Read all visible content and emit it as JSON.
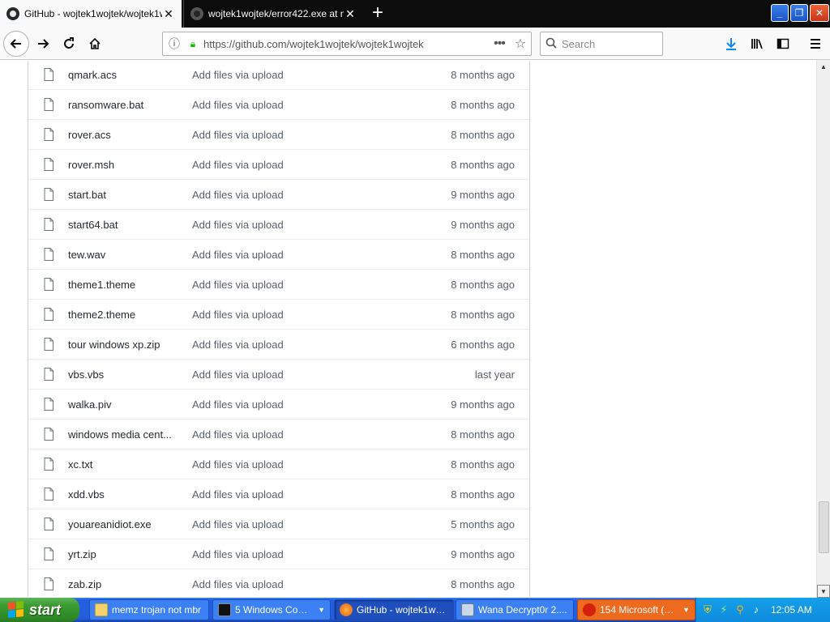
{
  "browser": {
    "tabs": [
      {
        "title": "GitHub - wojtek1wojtek/wojtek1w",
        "active": true
      },
      {
        "title": "wojtek1wojtek/error422.exe at m",
        "active": false
      }
    ],
    "new_tab_icon": "plus-icon",
    "url": "https://github.com/wojtek1wojtek/wojtek1wojtek",
    "search_placeholder": "Search"
  },
  "files": [
    {
      "name": "qmark.acs",
      "message": "Add files via upload",
      "age": "8 months ago"
    },
    {
      "name": "ransomware.bat",
      "message": "Add files via upload",
      "age": "8 months ago"
    },
    {
      "name": "rover.acs",
      "message": "Add files via upload",
      "age": "8 months ago"
    },
    {
      "name": "rover.msh",
      "message": "Add files via upload",
      "age": "8 months ago"
    },
    {
      "name": "start.bat",
      "message": "Add files via upload",
      "age": "9 months ago"
    },
    {
      "name": "start64.bat",
      "message": "Add files via upload",
      "age": "9 months ago"
    },
    {
      "name": "tew.wav",
      "message": "Add files via upload",
      "age": "8 months ago"
    },
    {
      "name": "theme1.theme",
      "message": "Add files via upload",
      "age": "8 months ago"
    },
    {
      "name": "theme2.theme",
      "message": "Add files via upload",
      "age": "8 months ago"
    },
    {
      "name": "tour windows xp.zip",
      "message": "Add files via upload",
      "age": "6 months ago"
    },
    {
      "name": "vbs.vbs",
      "message": "Add files via upload",
      "age": "last year"
    },
    {
      "name": "walka.piv",
      "message": "Add files via upload",
      "age": "9 months ago"
    },
    {
      "name": "windows media cent...",
      "message": "Add files via upload",
      "age": "8 months ago"
    },
    {
      "name": "xc.txt",
      "message": "Add files via upload",
      "age": "8 months ago"
    },
    {
      "name": "xdd.vbs",
      "message": "Add files via upload",
      "age": "8 months ago"
    },
    {
      "name": "youareanidiot.exe",
      "message": "Add files via upload",
      "age": "5 months ago"
    },
    {
      "name": "yrt.zip",
      "message": "Add files via upload",
      "age": "9 months ago"
    },
    {
      "name": "zab.zip",
      "message": "Add files via upload",
      "age": "8 months ago"
    }
  ],
  "taskbar": {
    "start_label": "start",
    "items": [
      {
        "label": "memz trojan not mbr",
        "icon": "folder-icon",
        "active": false
      },
      {
        "label": "5 Windows Comm...",
        "icon": "console-icon",
        "active": false
      },
      {
        "label": "GitHub - wojtek1wo...",
        "icon": "firefox-icon",
        "active": true
      },
      {
        "label": "Wana Decrypt0r 2....",
        "icon": "wanacry-icon",
        "active": false
      },
      {
        "label": "154 Microsoft (R)...",
        "icon": "error-icon",
        "active": false
      }
    ],
    "clock": "12:05 AM"
  },
  "colors": {
    "taskbar_blue": "#245edc",
    "start_green": "#3c9c32",
    "tray_blue": "#0f8bdd",
    "github_text": "#24292e",
    "muted_text": "#586069"
  }
}
